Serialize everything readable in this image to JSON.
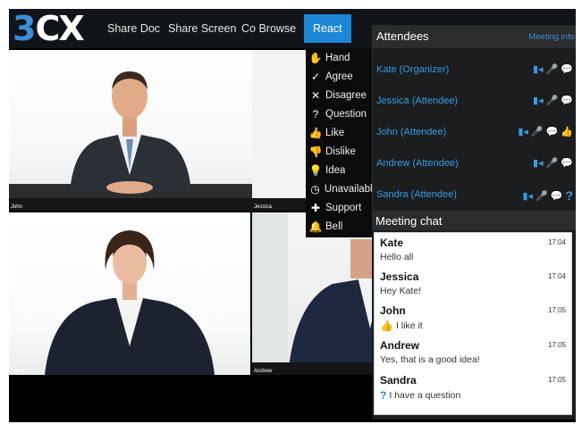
{
  "app": {
    "logo_part1": "3",
    "logo_part2": "CX"
  },
  "nav": {
    "share_doc": "Share Doc",
    "share_screen": "Share Screen",
    "co_browse": "Co Browse",
    "react": "React"
  },
  "video_tiles": {
    "john": "John",
    "jessica": "Jessica",
    "sandra": "Sandra",
    "andrew": "Andrew"
  },
  "react_menu": [
    {
      "label": "Hand",
      "icon": "hand-icon"
    },
    {
      "label": "Agree",
      "icon": "check-icon"
    },
    {
      "label": "Disagree",
      "icon": "x-icon"
    },
    {
      "label": "Question",
      "icon": "question-icon"
    },
    {
      "label": "Like",
      "icon": "thumbs-up-icon"
    },
    {
      "label": "Dislike",
      "icon": "thumbs-down-icon"
    },
    {
      "label": "Idea",
      "icon": "lightbulb-icon"
    },
    {
      "label": "Unavailable",
      "icon": "clock-icon"
    },
    {
      "label": "Support",
      "icon": "first-aid-icon"
    },
    {
      "label": "Bell",
      "icon": "bell-icon"
    }
  ],
  "attendees": {
    "title": "Attendees",
    "meeting_info": "Meeting info",
    "list": [
      {
        "name": "Kate (Organizer)",
        "reaction": ""
      },
      {
        "name": "Jessica (Attendee)",
        "reaction": ""
      },
      {
        "name": "John (Attendee)",
        "reaction": "like"
      },
      {
        "name": "Andrew (Attendee)",
        "reaction": ""
      },
      {
        "name": "Sandra (Attendee)",
        "reaction": "question"
      }
    ]
  },
  "chat": {
    "title": "Meeting chat",
    "messages": [
      {
        "sender": "Kate",
        "time": "17:04",
        "text": "Hello all",
        "icon": ""
      },
      {
        "sender": "Jessica",
        "time": "17:04",
        "text": "Hey Kate!",
        "icon": ""
      },
      {
        "sender": "John",
        "time": "17:05",
        "text": "I like it",
        "icon": "thumbs-up-icon"
      },
      {
        "sender": "Andrew",
        "time": "17:05",
        "text": "Yes, that is a good idea!",
        "icon": ""
      },
      {
        "sender": "Sandra",
        "time": "17:05",
        "text": "I have a question",
        "icon": "question-icon"
      }
    ]
  },
  "colors": {
    "accent": "#1d86d6",
    "link": "#3a9ae0",
    "panel": "#1b1d1f",
    "header": "#2a2c2e"
  }
}
